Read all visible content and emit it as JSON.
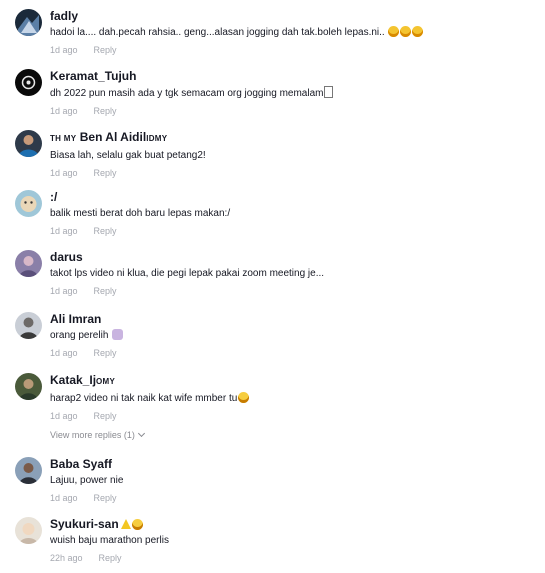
{
  "comments": [
    {
      "name": "fadly",
      "text": "hadoi la.... dah.pecah rahsia.. geng...alasan jogging dah tak.boleh lepas.ni..",
      "time": "1d ago",
      "reply": "Reply"
    },
    {
      "name": "Keramat_Tujuh",
      "text": "dh 2022 pun masih ada y tgk semacam org jogging memalam",
      "time": "1d ago",
      "reply": "Reply"
    },
    {
      "name_prefix": "TH MY",
      "name": "Ben Al Aidil",
      "name_suffix": "IDMY",
      "text": "Biasa lah, selalu gak buat petang2!",
      "time": "1d ago",
      "reply": "Reply"
    },
    {
      "name": ":/",
      "text": "balik mesti berat doh baru lepas makan:/",
      "time": "1d ago",
      "reply": "Reply"
    },
    {
      "name": "darus",
      "text": "takot lps video ni klua, die pegi lepak pakai zoom meeting je...",
      "time": "1d ago",
      "reply": "Reply"
    },
    {
      "name": "Ali Imran",
      "text": "orang perelih",
      "time": "1d ago",
      "reply": "Reply"
    },
    {
      "name": "Katak_Ij",
      "name_suffix": "OMY",
      "text": "harap2 video ni tak naik kat wife mmber tu",
      "time": "1d ago",
      "reply": "Reply"
    },
    {
      "name": "Baba Syaff",
      "text": "Lajuu, power nie",
      "time": "1d ago",
      "reply": "Reply"
    },
    {
      "name": "Syukuri-san",
      "text": "wuish baju marathon perlis",
      "time": "22h ago",
      "reply": "Reply"
    }
  ],
  "view_more": "View more replies (1)"
}
